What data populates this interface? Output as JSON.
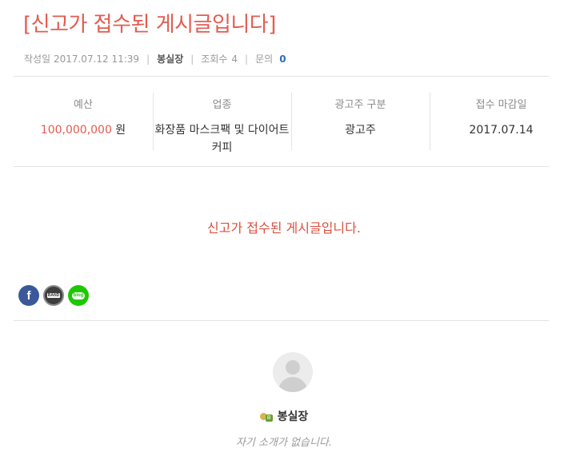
{
  "post": {
    "title": "[신고가 접수된 게시글입니다]",
    "meta": {
      "date_label": "작성일",
      "date": "2017.07.12 11:39",
      "author": "봉실장",
      "views_label": "조회수",
      "views": "4",
      "inquiry_label": "문의",
      "inquiry": "0"
    },
    "info": {
      "budget_label": "예산",
      "budget_value": "100,000,000",
      "budget_unit": " 원",
      "industry_label": "업종",
      "industry_value": "화장품 마스크팩 및 다이어트커피",
      "advertiser_label": "광고주 구분",
      "advertiser_value": "광고주",
      "deadline_label": "접수 마감일",
      "deadline_value": "2017.07.14"
    },
    "notice": "신고가 접수된 게시글입니다."
  },
  "share": {
    "facebook_icon": "f",
    "band_icon": "BAND",
    "blog_icon": "blog"
  },
  "profile": {
    "name": "봉실장",
    "level_badge": "B",
    "intro": "자기 소개가 없습니다."
  },
  "colors": {
    "accent_red": "#e45b4f",
    "inquiry_blue": "#2b6cb8",
    "facebook": "#3b5998",
    "naver_blog": "#1ec800"
  }
}
